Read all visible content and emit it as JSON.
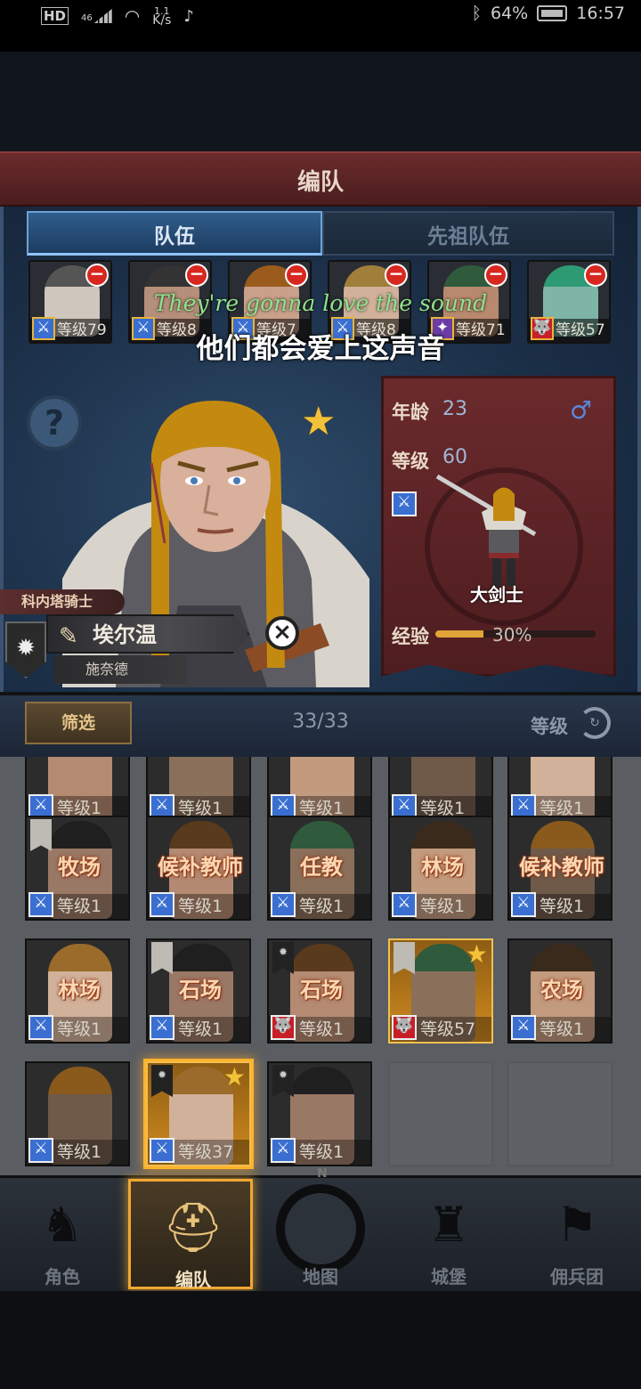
{
  "status_bar": {
    "hd": "HD",
    "signal_label": "46",
    "net_speed_value": "1.1",
    "net_speed_unit": "K/s",
    "battery": "64%",
    "time": "16:57"
  },
  "header": {
    "title": "编队"
  },
  "tabs": [
    {
      "label": "队伍",
      "active": true
    },
    {
      "label": "先祖队伍",
      "active": false
    }
  ],
  "team": [
    {
      "level": "等级79",
      "class_icon": "sword-icon",
      "class_color": "#3a6fd1"
    },
    {
      "level": "等级8",
      "class_icon": "sword-icon",
      "class_color": "#3a6fd1"
    },
    {
      "level": "等级7",
      "class_icon": "sword-icon",
      "class_color": "#3a6fd1"
    },
    {
      "level": "等级8",
      "class_icon": "sword-icon",
      "class_color": "#3a6fd1"
    },
    {
      "level": "等级71",
      "class_icon": "magic-icon",
      "class_color": "#6c3ca6"
    },
    {
      "level": "等级57",
      "class_icon": "wolf-icon",
      "class_color": "#c81e28"
    }
  ],
  "subtitle": {
    "en": "They're gonna love the sound",
    "zh": "他们都会爱上这声音"
  },
  "hero": {
    "title": "科内塔骑士",
    "name": "埃尔温",
    "surname": "施奈德",
    "age_label": "年龄",
    "age": "23",
    "level_label": "等级",
    "level": "60",
    "class_name": "大剑士",
    "xp_label": "经验",
    "xp_percent": "30%",
    "xp_value": 0.3,
    "gender_icon": "male-icon"
  },
  "filter": {
    "button": "筛选",
    "count": "33/33",
    "sort_label": "等级"
  },
  "grid_rows": [
    [
      {
        "job": "",
        "level": "等级1"
      },
      {
        "job": "",
        "level": "等级1"
      },
      {
        "job": "",
        "level": "等级1"
      },
      {
        "job": "",
        "level": "等级1"
      },
      {
        "job": "",
        "level": "等级1"
      }
    ],
    [
      {
        "job": "牧场",
        "level": "等级1"
      },
      {
        "job": "候补教师",
        "level": "等级1"
      },
      {
        "job": "任教",
        "level": "等级1"
      },
      {
        "job": "林场",
        "level": "等级1"
      },
      {
        "job": "候补教师",
        "level": "等级1"
      }
    ],
    [
      {
        "job": "林场",
        "level": "等级1"
      },
      {
        "job": "石场",
        "level": "等级1"
      },
      {
        "job": "石场",
        "level": "等级1"
      },
      {
        "job": "",
        "level": "等级57"
      },
      {
        "job": "农场",
        "level": "等级1"
      }
    ],
    [
      {
        "job": "",
        "level": "等级1"
      },
      {
        "job": "",
        "level": "等级37"
      },
      {
        "job": "",
        "level": "等级1"
      }
    ]
  ],
  "nav": [
    {
      "label": "角色",
      "icon": "knight-icon"
    },
    {
      "label": "编队",
      "icon": "helmet-icon",
      "active": true
    },
    {
      "label": "地图",
      "icon": "compass-icon",
      "compass_letter": "N"
    },
    {
      "label": "城堡",
      "icon": "castle-icon"
    },
    {
      "label": "佣兵团",
      "icon": "mercenary-icon"
    }
  ]
}
